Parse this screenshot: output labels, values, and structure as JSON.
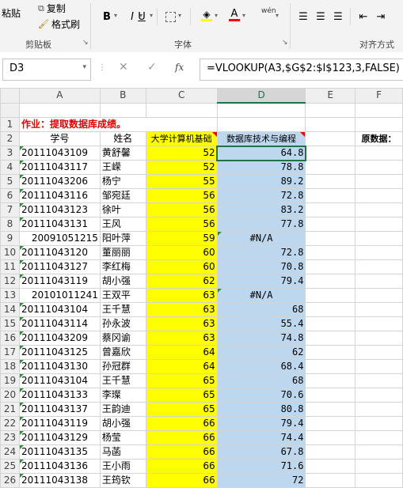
{
  "ribbon": {
    "clipboard": {
      "paste": "粘贴",
      "copy": "复制",
      "format_painter": "格式刷",
      "label": "剪贴板"
    },
    "font": {
      "label": "字体",
      "bold": "B",
      "italic": "I",
      "underline": "U",
      "font_color_letter": "A",
      "phonetic": "wén",
      "font_color": "#ff0000",
      "fill_color": "#ffff00"
    },
    "alignment": {
      "label": "对齐方式"
    }
  },
  "formula_bar": {
    "name_box": "D3",
    "cancel": "✕",
    "confirm": "✓",
    "fx": "fx",
    "formula": "=VLOOKUP(A3,$G$2:$I$123,3,FALSE)"
  },
  "columns": [
    "A",
    "B",
    "C",
    "D",
    "E",
    "F"
  ],
  "selected_column": "D",
  "row1": {
    "title": "作业：提取数据库成绩。"
  },
  "row2": {
    "headers": [
      "学号",
      "姓名",
      "大学计算机基础",
      "数据库技术与编程"
    ],
    "side_label": "原数据："
  },
  "rows": [
    {
      "n": "3",
      "id": "20111043109",
      "name": "黄舒馨",
      "c": "52",
      "d": "64.8"
    },
    {
      "n": "4",
      "id": "20111043117",
      "name": "王嵘",
      "c": "52",
      "d": "78.8"
    },
    {
      "n": "5",
      "id": "20111043206",
      "name": "杨宁",
      "c": "55",
      "d": "89.2"
    },
    {
      "n": "6",
      "id": "20111043116",
      "name": "邹宛廷",
      "c": "56",
      "d": "72.8"
    },
    {
      "n": "7",
      "id": "20111043123",
      "name": "徐叶",
      "c": "56",
      "d": "83.2"
    },
    {
      "n": "8",
      "id": "20111043131",
      "name": "王风",
      "c": "56",
      "d": "77.8"
    },
    {
      "n": "9",
      "id": "20091051215",
      "name": "阳叶萍",
      "c": "59",
      "d": "#N/A"
    },
    {
      "n": "10",
      "id": "20111043120",
      "name": "董丽丽",
      "c": "60",
      "d": "72.8"
    },
    {
      "n": "11",
      "id": "20111043127",
      "name": "李红梅",
      "c": "60",
      "d": "70.8"
    },
    {
      "n": "12",
      "id": "20111043119",
      "name": "胡小强",
      "c": "62",
      "d": "79.4"
    },
    {
      "n": "13",
      "id": "20101011241",
      "name": "王双平",
      "c": "63",
      "d": "#N/A"
    },
    {
      "n": "14",
      "id": "20111043104",
      "name": "王千慧",
      "c": "63",
      "d": "68"
    },
    {
      "n": "15",
      "id": "20111043114",
      "name": "孙永波",
      "c": "63",
      "d": "55.4"
    },
    {
      "n": "16",
      "id": "20111043209",
      "name": "蔡冈谕",
      "c": "63",
      "d": "74.8"
    },
    {
      "n": "17",
      "id": "20111043125",
      "name": "曾嘉欣",
      "c": "64",
      "d": "62"
    },
    {
      "n": "18",
      "id": "20111043130",
      "name": "孙冠群",
      "c": "64",
      "d": "68.4"
    },
    {
      "n": "19",
      "id": "20111043104",
      "name": "王千慧",
      "c": "65",
      "d": "68"
    },
    {
      "n": "20",
      "id": "20111043133",
      "name": "李璨",
      "c": "65",
      "d": "70.6"
    },
    {
      "n": "21",
      "id": "20111043137",
      "name": "王韵迪",
      "c": "65",
      "d": "80.8"
    },
    {
      "n": "22",
      "id": "20111043119",
      "name": "胡小强",
      "c": "66",
      "d": "79.4"
    },
    {
      "n": "23",
      "id": "20111043129",
      "name": "杨莹",
      "c": "66",
      "d": "74.4"
    },
    {
      "n": "24",
      "id": "20111043135",
      "name": "马菡",
      "c": "66",
      "d": "67.8"
    },
    {
      "n": "25",
      "id": "20111043136",
      "name": "王小雨",
      "c": "66",
      "d": "71.6"
    },
    {
      "n": "26",
      "id": "20111043138",
      "name": "王筠钦",
      "c": "66",
      "d": "72"
    }
  ]
}
